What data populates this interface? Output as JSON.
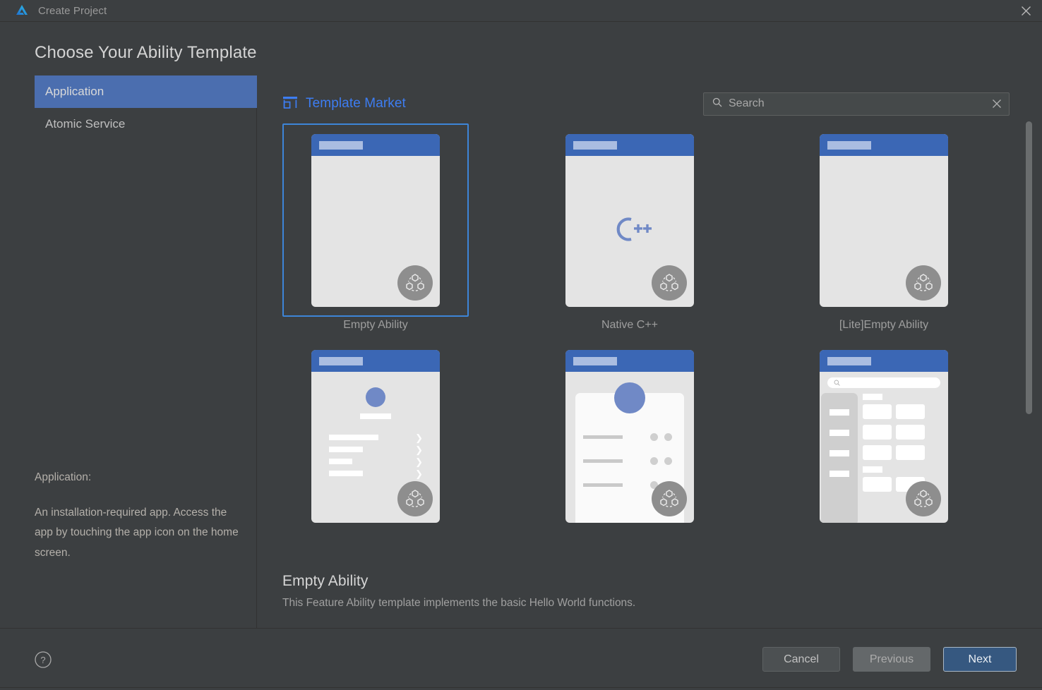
{
  "window": {
    "title": "Create Project",
    "logo_icon": "devtools-logo-icon",
    "close_icon": "close-icon"
  },
  "page": {
    "heading": "Choose Your Ability Template"
  },
  "sidebar": {
    "items": [
      {
        "label": "Application",
        "selected": true
      },
      {
        "label": "Atomic Service",
        "selected": false
      }
    ],
    "description": {
      "lead": "Application:",
      "text": "An installation-required app. Access the app by touching the app icon on the home screen."
    }
  },
  "market": {
    "icon": "store-icon",
    "label": "Template Market"
  },
  "search": {
    "icon": "search-icon",
    "placeholder": "Search",
    "value": "",
    "clear_icon": "close-icon"
  },
  "templates": [
    {
      "label": "Empty Ability",
      "kind": "blank",
      "selected": true
    },
    {
      "label": "Native C++",
      "kind": "cpp",
      "selected": false,
      "glyph": "C++"
    },
    {
      "label": "[Lite]Empty Ability",
      "kind": "blank",
      "selected": false
    },
    {
      "label": "",
      "kind": "list",
      "selected": false
    },
    {
      "label": "",
      "kind": "profile",
      "selected": false
    },
    {
      "label": "",
      "kind": "catalog",
      "selected": false
    }
  ],
  "selection": {
    "title": "Empty Ability",
    "description": "This Feature Ability template implements the basic Hello World functions."
  },
  "footer": {
    "help_icon": "help-circle-icon",
    "buttons": [
      {
        "label": "Cancel",
        "style": "cancel"
      },
      {
        "label": "Previous",
        "style": "previous"
      },
      {
        "label": "Next",
        "style": "next"
      }
    ]
  },
  "colors": {
    "background": "#3c3f41",
    "accent_blue": "#4b6eaf",
    "link_blue": "#3d7df2",
    "selection_border": "#3d85d8",
    "primary_button": "#365880"
  }
}
